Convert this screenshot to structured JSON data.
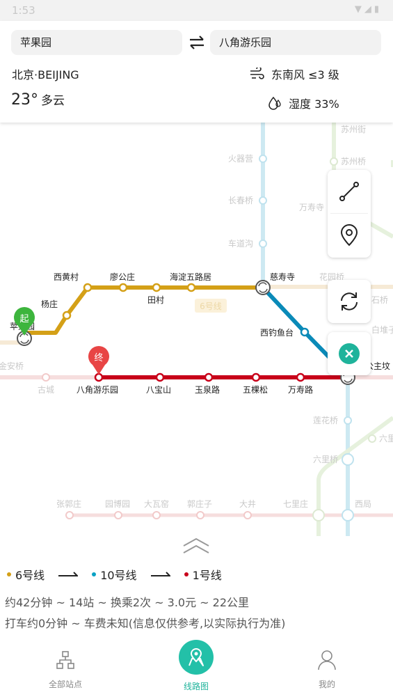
{
  "status_bar": {
    "time": "1:53"
  },
  "route": {
    "from": "苹果园",
    "to": "八角游乐园"
  },
  "weather": {
    "city": "北京·BEIJING",
    "wind": "东南风 ≤3 级",
    "temperature": "23°",
    "condition": "多云",
    "humidity": "湿度 33%"
  },
  "map": {
    "line6_label": "6号线",
    "start_marker": "起",
    "end_marker": "终",
    "route_stations": [
      "苹果园",
      "杨庄",
      "西黄村",
      "廖公庄",
      "田村",
      "海淀五路居",
      "慈寿寺",
      "西钓鱼台",
      "八角游乐园",
      "八宝山",
      "玉泉路",
      "五棵松",
      "万寿路",
      "公主坟"
    ],
    "faded_stations": [
      "火器营",
      "长春桥",
      "车道沟",
      "苏州街",
      "苏州桥",
      "万寿寺",
      "花园桥",
      "石桥",
      "白堆子",
      "金安桥",
      "古城",
      "莲花桥",
      "六里桥",
      "六里",
      "张郭庄",
      "园博园",
      "大瓦窑",
      "郭庄子",
      "大井",
      "七里庄",
      "西局"
    ]
  },
  "legend": [
    {
      "name": "6号线",
      "color": "#d4a017"
    },
    {
      "name": "10号线",
      "color": "#0aa1c4"
    },
    {
      "name": "1号线",
      "color": "#c8001a"
    }
  ],
  "summary": {
    "line1": "约42分钟 ~ 14站 ~ 换乘2次 ~ 3.0元 ~ 22公里",
    "line2": "打车约0分钟 ~ 车费未知(信息仅供参考,以实际执行为准)"
  },
  "nav": {
    "all_stations": "全部站点",
    "route_map": "线路图",
    "mine": "我的"
  }
}
